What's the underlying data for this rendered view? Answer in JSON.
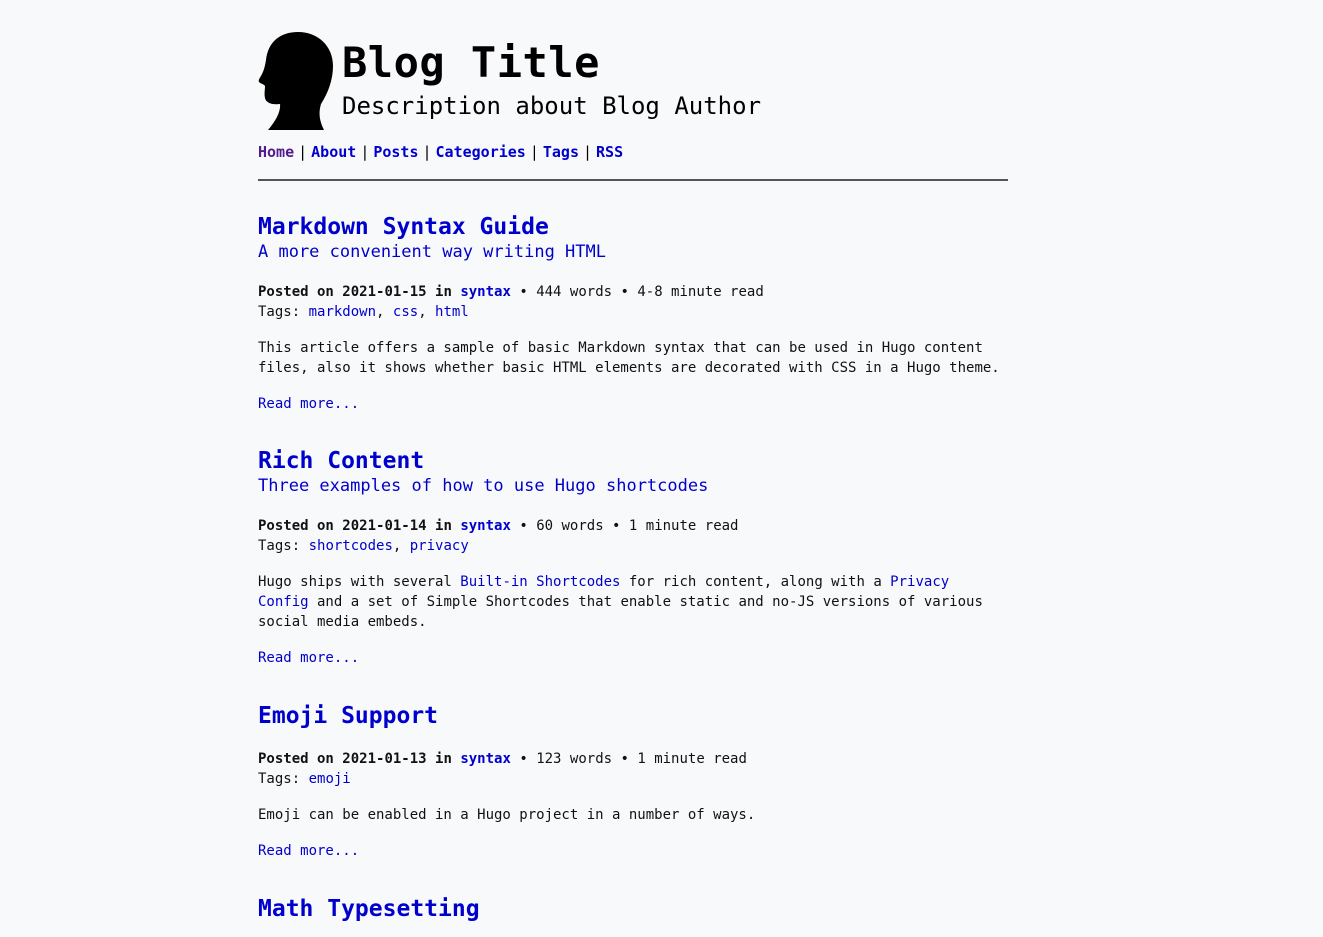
{
  "site": {
    "title": "Blog Title",
    "description": "Description about Blog Author"
  },
  "nav": {
    "items": [
      {
        "label": "Home"
      },
      {
        "label": "About"
      },
      {
        "label": "Posts"
      },
      {
        "label": "Categories"
      },
      {
        "label": "Tags"
      },
      {
        "label": "RSS"
      }
    ],
    "separator": "|"
  },
  "posts": [
    {
      "title": "Markdown Syntax Guide",
      "subtitle": "A more convenient way writing HTML",
      "posted_prefix": "Posted on",
      "date": "2021-01-15",
      "in_label": "in",
      "category": "syntax",
      "stats": "• 444 words • 4-8 minute read",
      "tags_label": "Tags:",
      "tags": [
        "markdown",
        "css",
        "html"
      ],
      "excerpt": "This article offers a sample of basic Markdown syntax that can be used in Hugo content files, also it shows whether basic HTML elements are decorated with CSS in a Hugo theme.",
      "read_more": "Read more..."
    },
    {
      "title": "Rich Content",
      "subtitle": "Three examples of how to use Hugo shortcodes",
      "posted_prefix": "Posted on",
      "date": "2021-01-14",
      "in_label": "in",
      "category": "syntax",
      "stats": "• 60 words • 1 minute read",
      "tags_label": "Tags:",
      "tags": [
        "shortcodes",
        "privacy"
      ],
      "excerpt_parts": {
        "a": "Hugo ships with several ",
        "link1": "Built-in Shortcodes",
        "b": " for rich content, along with a ",
        "link2": "Privacy Config",
        "c": " and a set of Simple Shortcodes that enable static and no-JS versions of various social media embeds."
      },
      "read_more": "Read more..."
    },
    {
      "title": "Emoji Support",
      "posted_prefix": "Posted on",
      "date": "2021-01-13",
      "in_label": "in",
      "category": "syntax",
      "stats": "• 123 words • 1 minute read",
      "tags_label": "Tags:",
      "tags": [
        "emoji"
      ],
      "excerpt": "Emoji can be enabled in a Hugo project in a number of ways.",
      "read_more": "Read more..."
    },
    {
      "title": "Math Typesetting"
    }
  ],
  "colors": {
    "link": "#0000cc",
    "visited": "#551a8b",
    "background": "#f8f9fb",
    "text": "#111111"
  },
  "icons": {
    "avatar": "head-silhouette-icon"
  }
}
